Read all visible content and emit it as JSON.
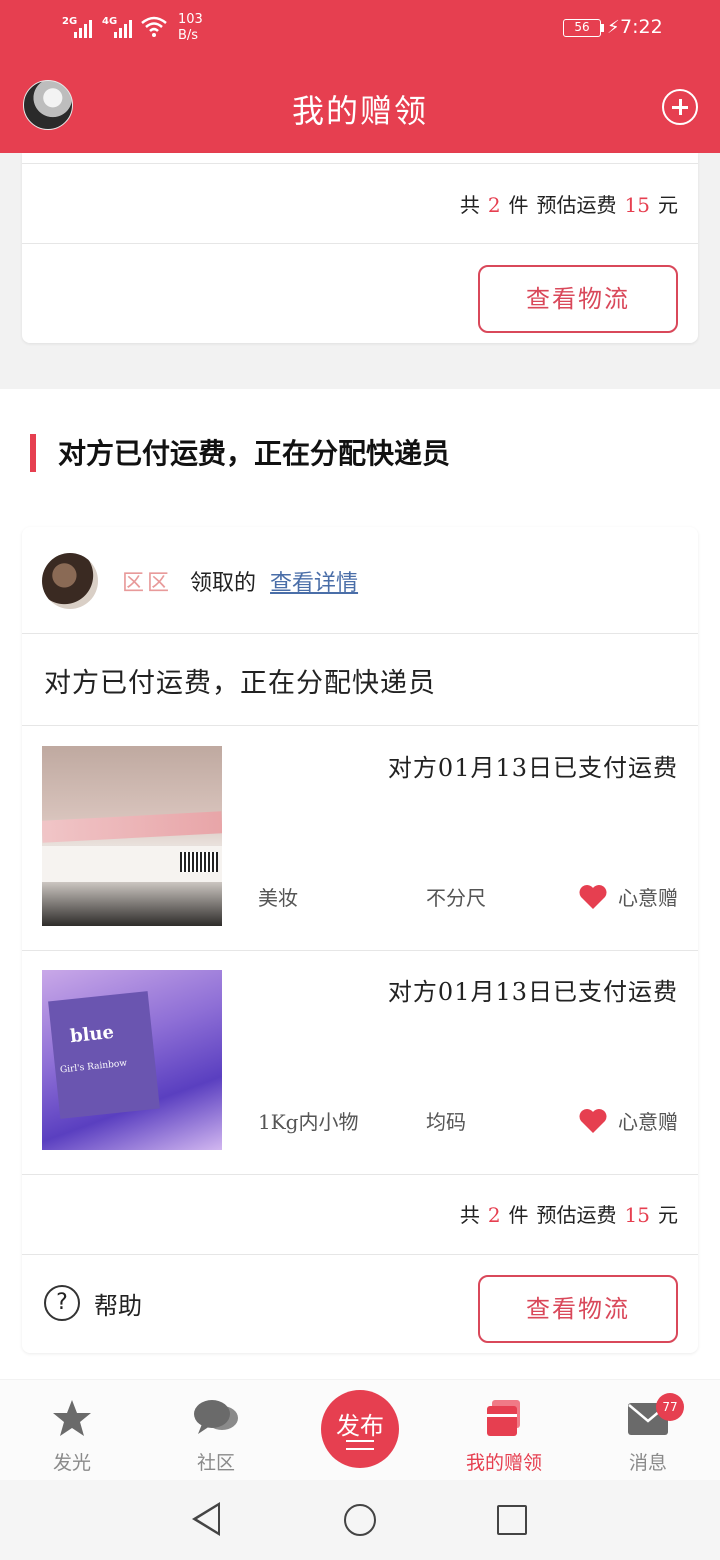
{
  "status_bar": {
    "sig1": "2G",
    "sig2": "4G",
    "speed_value": "103",
    "speed_unit": "B/s",
    "battery": "56",
    "time": "7:22"
  },
  "header": {
    "title": "我的赠领"
  },
  "top_card": {
    "summary": {
      "total_prefix": "共",
      "count": "2",
      "count_unit": "件",
      "fee_label": "预估运费",
      "fee": "15",
      "fee_unit": "元"
    },
    "logistics_button": "查看物流"
  },
  "section": {
    "title": "对方已付运费，正在分配快递员"
  },
  "order_card": {
    "user_name": "区区",
    "claimed_text": "领取的",
    "details_link": "查看详情",
    "status_text": "对方已付运费，正在分配快递员",
    "items": [
      {
        "paid_text": "对方01月13日已支付运费",
        "category": "美妆",
        "size": "不分尺",
        "gift_type": "心意赠"
      },
      {
        "paid_text": "对方01月13日已支付运费",
        "category": "1Kg内小物",
        "size": "均码",
        "gift_type": "心意赠",
        "thumb_text": "blue",
        "thumb_subtext": "Girl's Rainbow"
      }
    ],
    "summary": {
      "total_prefix": "共",
      "count": "2",
      "count_unit": "件",
      "fee_label": "预估运费",
      "fee": "15",
      "fee_unit": "元"
    },
    "help_icon_text": "?",
    "help_label": "帮助",
    "logistics_button": "查看物流"
  },
  "bottom_nav": {
    "items": [
      {
        "label": "发光",
        "icon": "star-icon"
      },
      {
        "label": "社区",
        "icon": "chat-bubbles-icon"
      },
      {
        "label": "发布",
        "icon": "publish-icon"
      },
      {
        "label": "我的赠领",
        "icon": "gift-cards-icon"
      },
      {
        "label": "消息",
        "icon": "mail-icon"
      }
    ],
    "message_badge": "77",
    "accent_color": "#e63f50"
  }
}
